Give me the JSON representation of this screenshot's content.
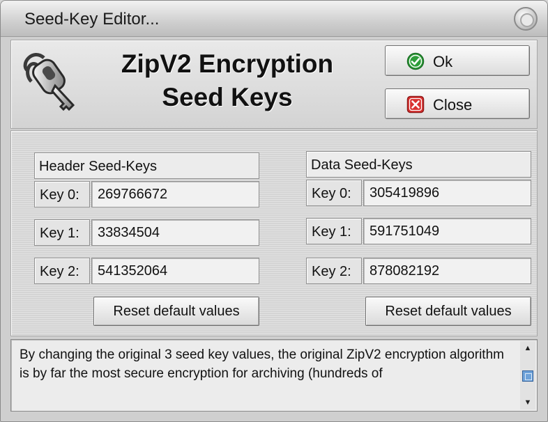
{
  "window": {
    "title": "Seed-Key Editor..."
  },
  "heading": {
    "line1": "ZipV2 Encryption",
    "line2": "Seed Keys"
  },
  "buttons": {
    "ok_label": "Ok",
    "close_label": "Close"
  },
  "icons": {
    "app": "key-icon",
    "ok": "check-icon",
    "close": "x-icon",
    "window_control": "circle-button-icon"
  },
  "colors": {
    "ok_icon": "#2e9e3a",
    "close_icon": "#d9302f",
    "scroll_thumb": "#6ea2d9"
  },
  "header_keys": {
    "title": "Header Seed-Keys",
    "keys": [
      {
        "label": "Key 0:",
        "value": "269766672"
      },
      {
        "label": "Key 1:",
        "value": "33834504"
      },
      {
        "label": "Key 2:",
        "value": "541352064"
      }
    ],
    "reset_label": "Reset default values"
  },
  "data_keys": {
    "title": "Data Seed-Keys",
    "keys": [
      {
        "label": "Key 0:",
        "value": "305419896"
      },
      {
        "label": "Key 1:",
        "value": "591751049"
      },
      {
        "label": "Key 2:",
        "value": "878082192"
      }
    ],
    "reset_label": "Reset default values"
  },
  "memo": {
    "text": "By changing the original 3 seed key values, the original ZipV2 encryption algorithm is by far the most secure encryption for archiving (hundreds of"
  }
}
